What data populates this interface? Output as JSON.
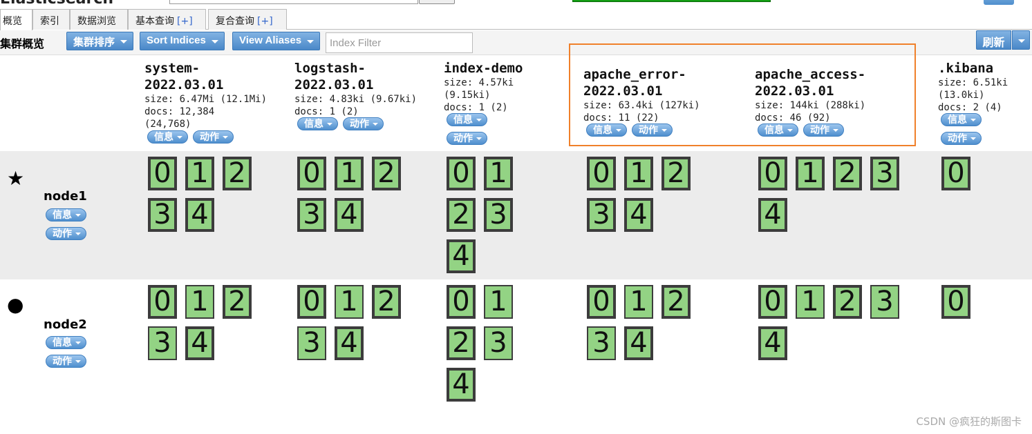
{
  "header": {
    "brand": "Elasticsearch"
  },
  "tabs": [
    {
      "label": "概览",
      "plus": ""
    },
    {
      "label": "索引",
      "plus": ""
    },
    {
      "label": "数据浏览",
      "plus": ""
    },
    {
      "label": "基本查询",
      "plus": "[+]"
    },
    {
      "label": "复合查询",
      "plus": "[+]"
    }
  ],
  "toolbar": {
    "title": "集群概览",
    "cluster_sort": "集群排序",
    "sort_indices": "Sort Indices",
    "view_aliases": "View Aliases",
    "filter_placeholder": "Index Filter",
    "refresh": "刷新"
  },
  "labels": {
    "info": "信息",
    "action": "动作"
  },
  "indices": [
    {
      "name1": "system-",
      "name2": "2022.03.01",
      "size": "size: 6.47Mi (12.1Mi)",
      "docs1": "docs: 12,384",
      "docs2": "(24,768)"
    },
    {
      "name1": "logstash-",
      "name2": "2022.03.01",
      "size": "size: 4.83ki (9.67ki)",
      "docs1": "docs: 1 (2)",
      "docs2": ""
    },
    {
      "name1": "index-demo",
      "name2": "",
      "size": "size: 4.57ki",
      "size2": "(9.15ki)",
      "docs1": "docs: 1 (2)",
      "docs2": ""
    },
    {
      "name1": "apache_error-",
      "name2": "2022.03.01",
      "size": "size: 63.4ki (127ki)",
      "docs1": "docs: 11 (22)",
      "docs2": ""
    },
    {
      "name1": "apache_access-",
      "name2": "2022.03.01",
      "size": "size: 144ki (288ki)",
      "docs1": "docs: 46 (92)",
      "docs2": ""
    },
    {
      "name1": ".kibana",
      "name2": "",
      "size": "size: 6.51ki",
      "size2": "(13.0ki)",
      "docs1": "docs: 2 (4)",
      "docs2": ""
    }
  ],
  "nodes": [
    {
      "name": "node1",
      "icon": "star-icon",
      "icon_char": "★"
    },
    {
      "name": "node2",
      "icon": "circle-icon",
      "icon_char": "●"
    }
  ],
  "shard_numbers": [
    "0",
    "1",
    "2",
    "3",
    "4"
  ],
  "watermark": "CSDN @疯狂的斯图卡"
}
